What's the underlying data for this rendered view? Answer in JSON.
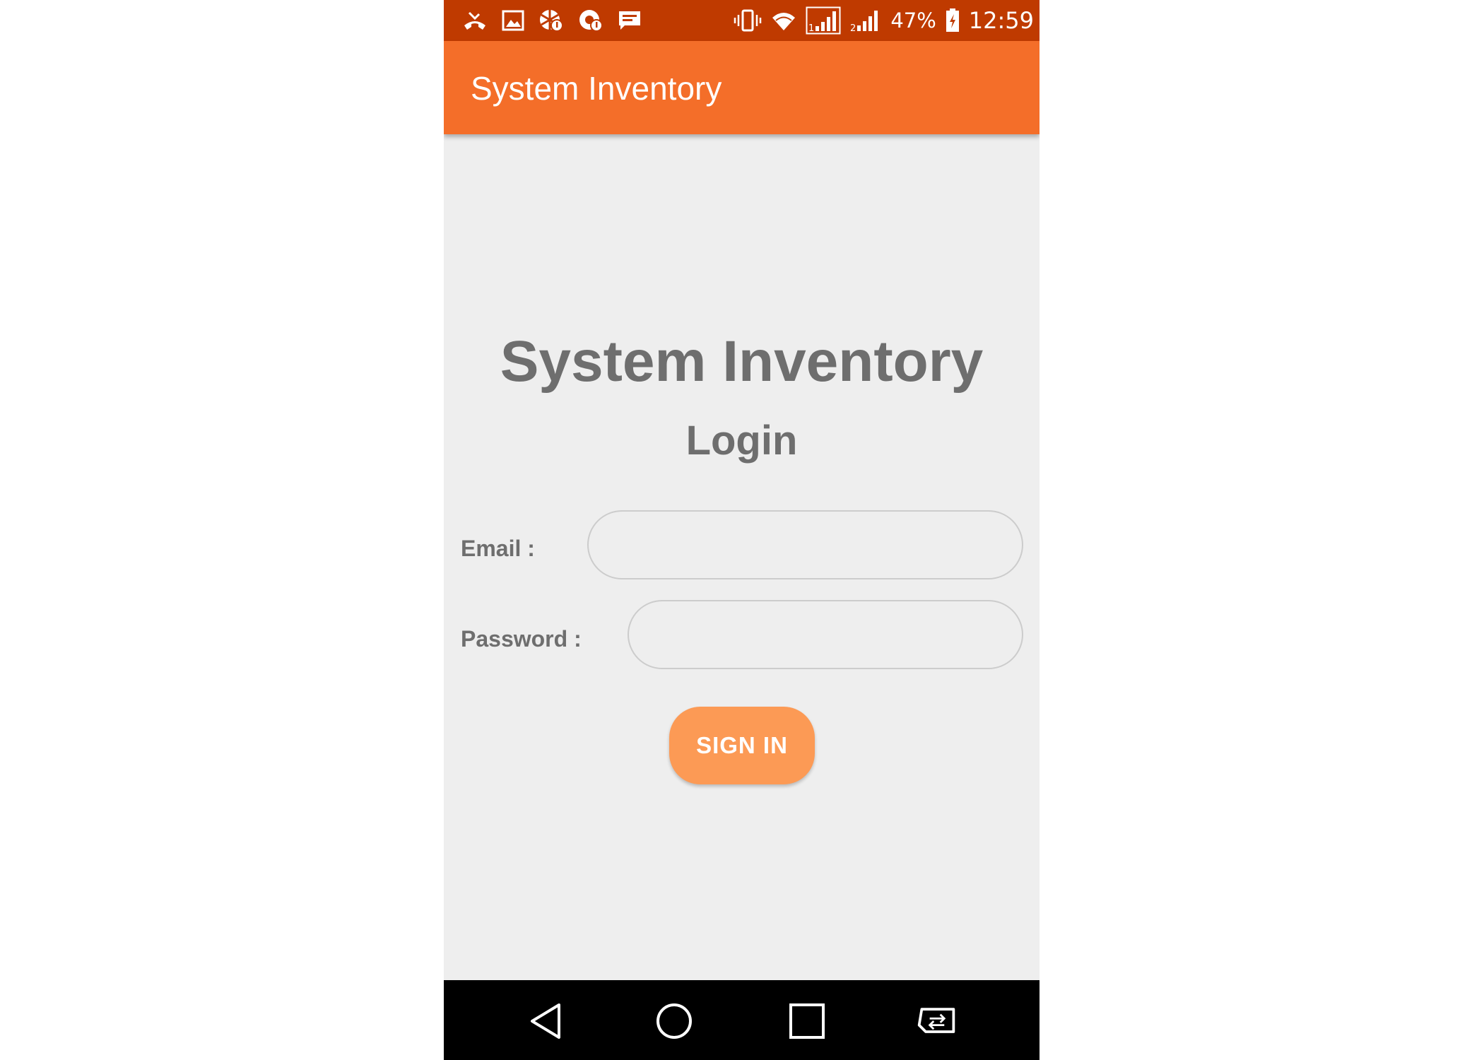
{
  "status_bar": {
    "battery_percent": "47%",
    "clock": "12:59",
    "left_icons": [
      "missed-call-icon",
      "gallery-icon",
      "notification-badge-icon",
      "notification-alert-icon",
      "message-icon"
    ],
    "right_icons": [
      "vibrate-icon",
      "wifi-icon",
      "signal-sim1-icon",
      "signal-sim2-icon",
      "battery-charging-icon"
    ]
  },
  "app_bar": {
    "title": "System Inventory"
  },
  "login": {
    "heading": "System Inventory",
    "subheading": "Login",
    "email_label": "Email :",
    "email_value": "",
    "password_label": "Password :",
    "password_value": "",
    "sign_in_label": "SIGN IN"
  },
  "nav_bar": {
    "buttons": [
      "back-icon",
      "home-icon",
      "recent-apps-icon",
      "screen-switch-icon"
    ]
  },
  "colors": {
    "status_bar": "#bf3a00",
    "app_bar": "#f46e29",
    "background": "#eeeeee",
    "button": "#fc9a55",
    "text": "#6e6e6e"
  }
}
